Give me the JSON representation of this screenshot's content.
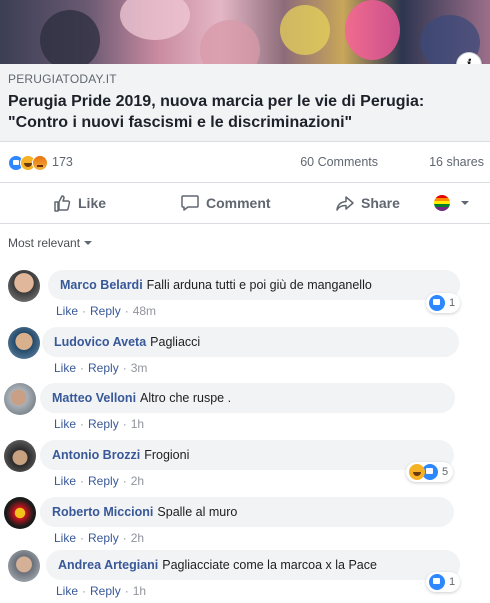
{
  "post": {
    "link": {
      "domain": "PERUGIATODAY.IT",
      "headline": "Perugia Pride 2019, nuova marcia per le vie di Perugia: \"Contro i nuovi fascismi e le discriminazioni\""
    },
    "info_glyph": "i",
    "reactions": {
      "icons": [
        "like",
        "haha",
        "angry"
      ],
      "count": "173"
    },
    "comments_count": "60 Comments",
    "shares_count": "16 shares",
    "actions": {
      "like": "Like",
      "comment": "Comment",
      "share": "Share"
    }
  },
  "sort_label": "Most relevant",
  "comments": [
    {
      "author": "Marco Belardi",
      "text": "Falli arduna tutti e poi giù de manganello",
      "like": "Like",
      "reply": "Reply",
      "time": "48m",
      "reaction_count": "1",
      "reaction_icons": [
        "like"
      ]
    },
    {
      "author": "Ludovico Aveta",
      "text": "Pagliacci",
      "like": "Like",
      "reply": "Reply",
      "time": "3m"
    },
    {
      "author": "Matteo Velloni",
      "text": "Altro che ruspe .",
      "like": "Like",
      "reply": "Reply",
      "time": "1h"
    },
    {
      "author": "Antonio Brozzi",
      "text": "Frogioni",
      "like": "Like",
      "reply": "Reply",
      "time": "2h",
      "reaction_count": "5",
      "reaction_icons": [
        "haha",
        "like"
      ]
    },
    {
      "author": "Roberto Miccioni",
      "text": "Spalle al muro",
      "like": "Like",
      "reply": "Reply",
      "time": "2h"
    },
    {
      "author": "Andrea Artegiani",
      "text": "Pagliacciate come la marcoa x la Pace",
      "like": "Like",
      "reply": "Reply",
      "time": "1h",
      "reaction_count": "1",
      "reaction_icons": [
        "like"
      ]
    }
  ],
  "colors": {
    "link_blue": "#385898",
    "bubble_bg": "#f2f3f5",
    "muted": "#606770",
    "like_blue": "#2d88ff"
  }
}
